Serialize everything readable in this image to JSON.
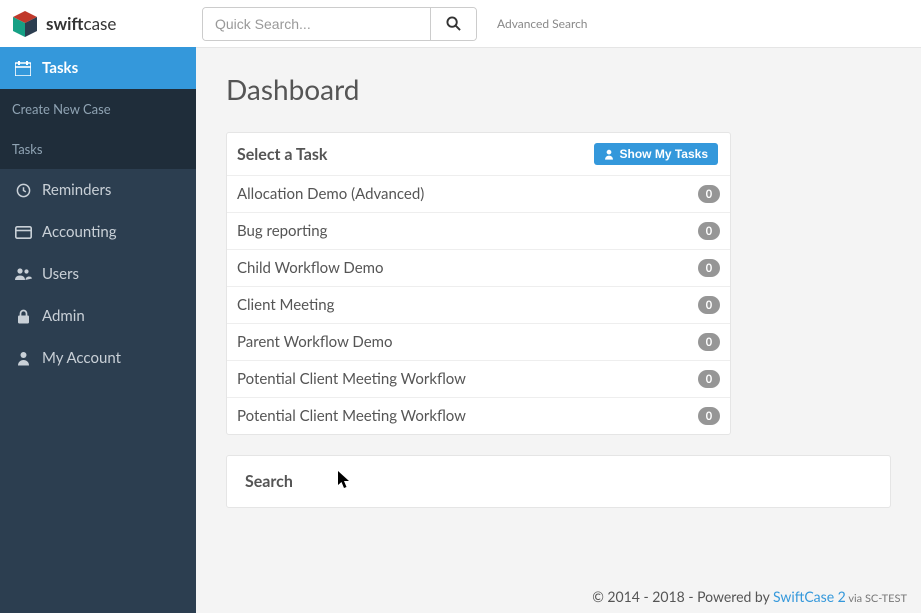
{
  "brand": {
    "name_bold": "swift",
    "name_light": "case"
  },
  "topbar": {
    "search_placeholder": "Quick Search...",
    "advanced_search": "Advanced Search"
  },
  "sidebar": {
    "items": [
      {
        "label": "Tasks"
      },
      {
        "label": "Reminders"
      },
      {
        "label": "Accounting"
      },
      {
        "label": "Users"
      },
      {
        "label": "Admin"
      },
      {
        "label": "My Account"
      }
    ],
    "sub_items": [
      {
        "label": "Create New Case"
      },
      {
        "label": "Tasks"
      }
    ]
  },
  "page": {
    "title": "Dashboard"
  },
  "task_panel": {
    "title": "Select a Task",
    "show_my_tasks": "Show My Tasks",
    "tasks": [
      {
        "name": "Allocation Demo (Advanced)",
        "count": "0"
      },
      {
        "name": "Bug reporting",
        "count": "0"
      },
      {
        "name": "Child Workflow Demo",
        "count": "0"
      },
      {
        "name": "Client Meeting",
        "count": "0"
      },
      {
        "name": "Parent Workflow Demo",
        "count": "0"
      },
      {
        "name": "Potential Client Meeting Workflow",
        "count": "0"
      },
      {
        "name": "Potential Client Meeting Workflow",
        "count": "0"
      }
    ]
  },
  "search_panel": {
    "title": "Search"
  },
  "footer": {
    "copyright": "© 2014 - 2018 - Powered by ",
    "link": "SwiftCase 2",
    "via": " via SC-TEST"
  }
}
